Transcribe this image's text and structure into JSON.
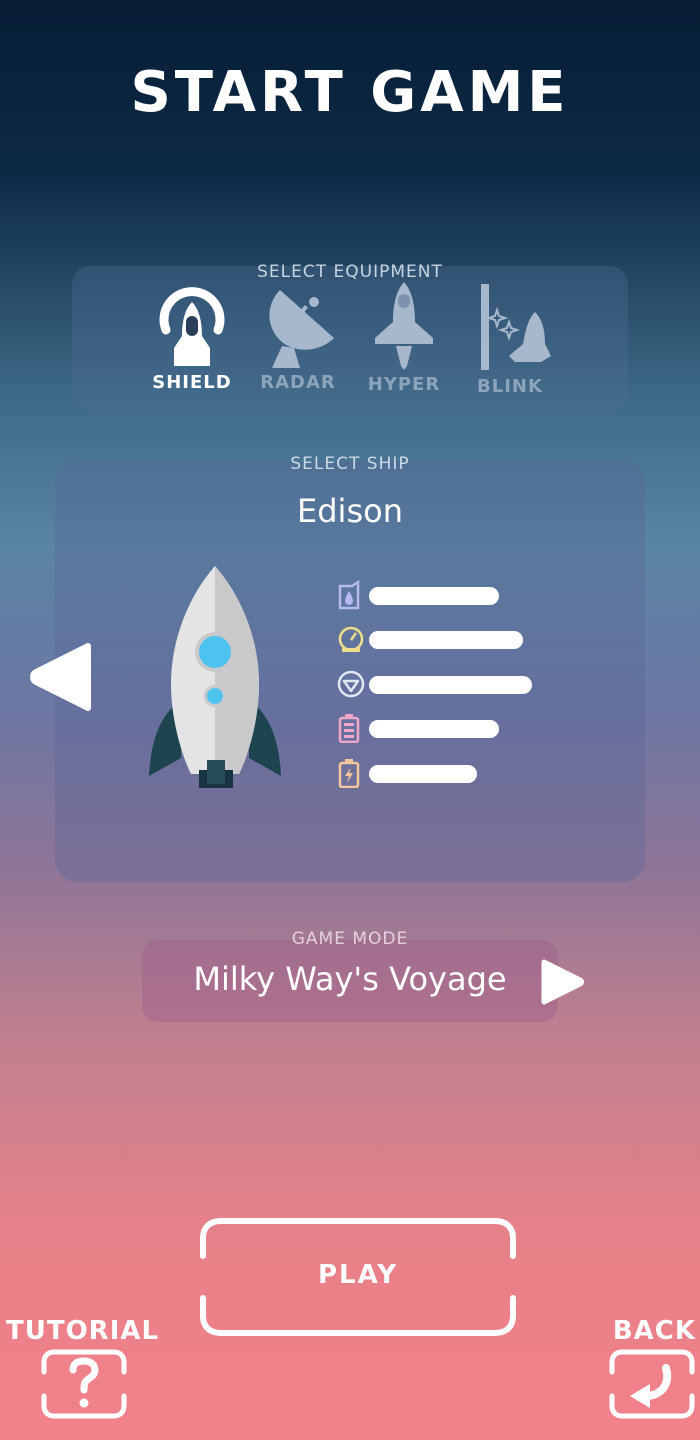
{
  "title": "START GAME",
  "equipment": {
    "header": "SELECT EQUIPMENT",
    "items": [
      {
        "label": "SHIELD",
        "icon": "shield-ship-icon",
        "selected": true
      },
      {
        "label": "RADAR",
        "icon": "radar-dish-icon",
        "selected": false
      },
      {
        "label": "HYPER",
        "icon": "hyper-ship-icon",
        "selected": false
      },
      {
        "label": "BLINK",
        "icon": "blink-ship-icon",
        "selected": false
      }
    ]
  },
  "ship": {
    "header": "SELECT SHIP",
    "name": "Edison",
    "stats": [
      {
        "icon": "fuel-icon",
        "color": "#b7b8f0",
        "level": 0.54
      },
      {
        "icon": "speed-gauge-icon",
        "color": "#f1e08a",
        "level": 0.64
      },
      {
        "icon": "shield-emblem-icon",
        "color": "#e0e7f3",
        "level": 0.68
      },
      {
        "icon": "battery-icon",
        "color": "#f0a7c9",
        "level": 0.54
      },
      {
        "icon": "energy-icon",
        "color": "#f6c79c",
        "level": 0.45
      }
    ]
  },
  "game_mode": {
    "header": "GAME MODE",
    "value": "Milky Way's Voyage"
  },
  "buttons": {
    "play": "PLAY",
    "tutorial": "TUTORIAL",
    "back": "BACK"
  },
  "colors": {
    "accent_blue": "#4dc3f0",
    "ship_body": "#e4e4e6",
    "fin": "#1e4450"
  }
}
